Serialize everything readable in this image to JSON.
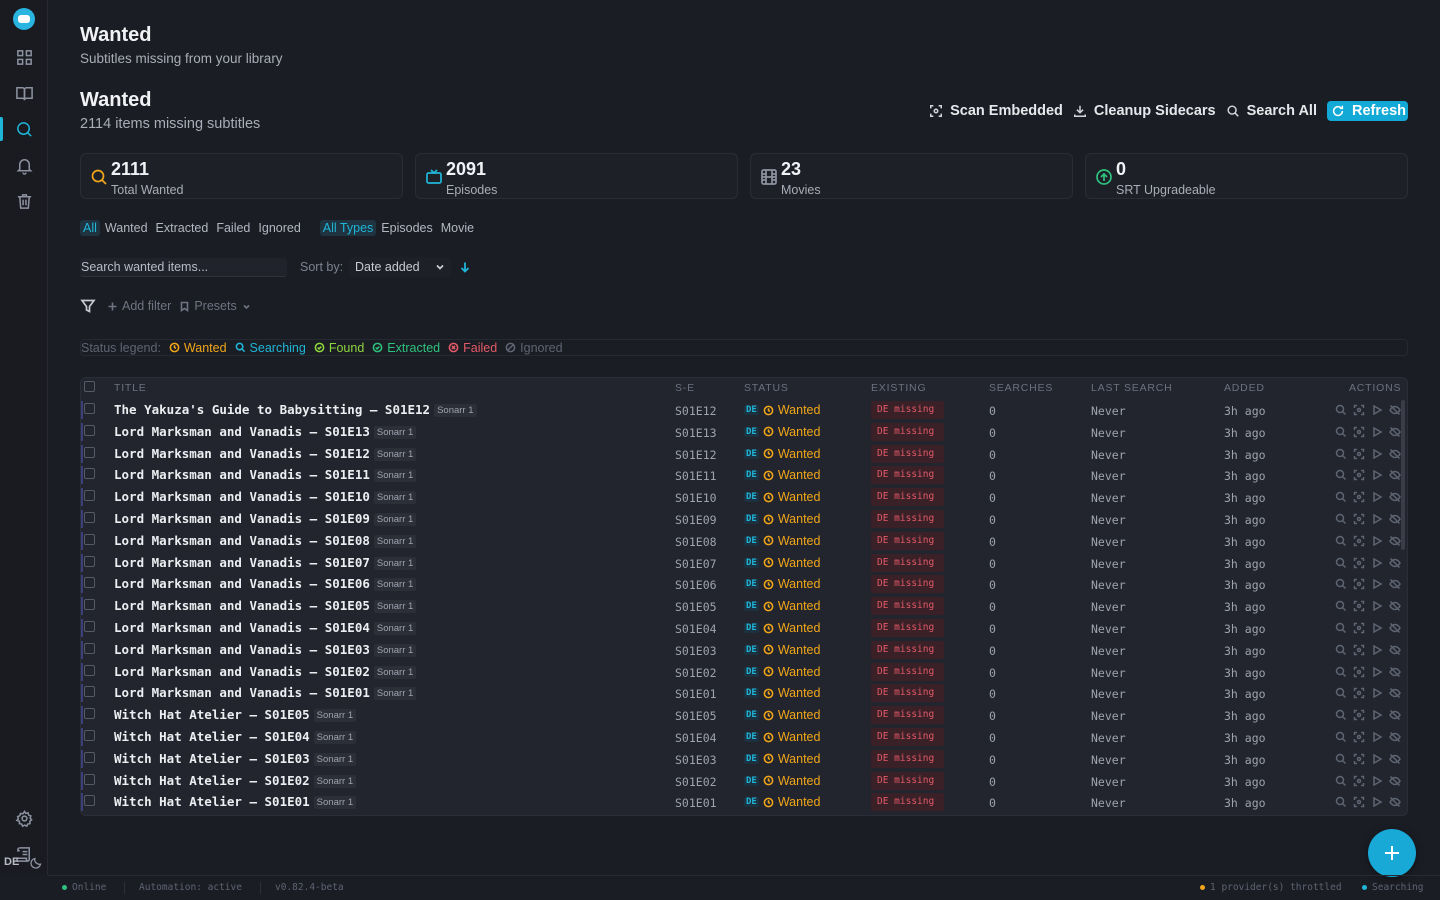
{
  "nav": {
    "items": [
      "dashboard-icon",
      "library-icon",
      "search-icon",
      "bell-icon",
      "trash-icon"
    ],
    "bottom": [
      "settings-icon",
      "log-icon"
    ],
    "language": "DE"
  },
  "page": {
    "title": "Wanted",
    "subtitle": "Subtitles missing from your library",
    "section_title": "Wanted",
    "section_subtitle": "2114 items missing subtitles"
  },
  "actions": {
    "scan": "Scan Embedded",
    "cleanup": "Cleanup Sidecars",
    "search_all": "Search All",
    "refresh": "Refresh"
  },
  "stats": [
    {
      "value": "2111",
      "label": "Total Wanted",
      "color": "#f1a61a"
    },
    {
      "value": "2091",
      "label": "Episodes",
      "color": "#1fb6d8"
    },
    {
      "value": "23",
      "label": "Movies",
      "color": "#8d92a0"
    },
    {
      "value": "0",
      "label": "SRT Upgradeable",
      "color": "#2ec27e"
    }
  ],
  "filters": {
    "status": [
      "All",
      "Wanted",
      "Extracted",
      "Failed",
      "Ignored"
    ],
    "types": [
      "All Types",
      "Episodes",
      "Movie"
    ]
  },
  "search": {
    "placeholder": "Search wanted items..."
  },
  "sort": {
    "label": "Sort by:",
    "value": "Date added"
  },
  "filterbar": {
    "add": "Add filter",
    "presets": "Presets"
  },
  "legend": {
    "label": "Status legend:",
    "items": [
      {
        "label": "Wanted",
        "color": "#f1a61a"
      },
      {
        "label": "Searching",
        "color": "#1fb6d8"
      },
      {
        "label": "Found",
        "color": "#8ed63e"
      },
      {
        "label": "Extracted",
        "color": "#2ec27e"
      },
      {
        "label": "Failed",
        "color": "#e35a68"
      },
      {
        "label": "Ignored",
        "color": "#5f6473"
      }
    ]
  },
  "table": {
    "headers": [
      "TITLE",
      "S-E",
      "STATUS",
      "EXISTING",
      "SEARCHES",
      "LAST SEARCH",
      "ADDED",
      "ACTIONS"
    ],
    "rows": [
      {
        "title": "The Yakuza's Guide to Babysitting – S01E12",
        "source": "Sonarr 1",
        "se": "S01E12",
        "lang": "DE",
        "status": "Wanted",
        "existing": "DE missing",
        "searches": "0",
        "last": "Never",
        "added": "3h ago"
      },
      {
        "title": "Lord Marksman and Vanadis – S01E13",
        "source": "Sonarr 1",
        "se": "S01E13",
        "lang": "DE",
        "status": "Wanted",
        "existing": "DE missing",
        "searches": "0",
        "last": "Never",
        "added": "3h ago"
      },
      {
        "title": "Lord Marksman and Vanadis – S01E12",
        "source": "Sonarr 1",
        "se": "S01E12",
        "lang": "DE",
        "status": "Wanted",
        "existing": "DE missing",
        "searches": "0",
        "last": "Never",
        "added": "3h ago"
      },
      {
        "title": "Lord Marksman and Vanadis – S01E11",
        "source": "Sonarr 1",
        "se": "S01E11",
        "lang": "DE",
        "status": "Wanted",
        "existing": "DE missing",
        "searches": "0",
        "last": "Never",
        "added": "3h ago"
      },
      {
        "title": "Lord Marksman and Vanadis – S01E10",
        "source": "Sonarr 1",
        "se": "S01E10",
        "lang": "DE",
        "status": "Wanted",
        "existing": "DE missing",
        "searches": "0",
        "last": "Never",
        "added": "3h ago"
      },
      {
        "title": "Lord Marksman and Vanadis – S01E09",
        "source": "Sonarr 1",
        "se": "S01E09",
        "lang": "DE",
        "status": "Wanted",
        "existing": "DE missing",
        "searches": "0",
        "last": "Never",
        "added": "3h ago"
      },
      {
        "title": "Lord Marksman and Vanadis – S01E08",
        "source": "Sonarr 1",
        "se": "S01E08",
        "lang": "DE",
        "status": "Wanted",
        "existing": "DE missing",
        "searches": "0",
        "last": "Never",
        "added": "3h ago"
      },
      {
        "title": "Lord Marksman and Vanadis – S01E07",
        "source": "Sonarr 1",
        "se": "S01E07",
        "lang": "DE",
        "status": "Wanted",
        "existing": "DE missing",
        "searches": "0",
        "last": "Never",
        "added": "3h ago"
      },
      {
        "title": "Lord Marksman and Vanadis – S01E06",
        "source": "Sonarr 1",
        "se": "S01E06",
        "lang": "DE",
        "status": "Wanted",
        "existing": "DE missing",
        "searches": "0",
        "last": "Never",
        "added": "3h ago"
      },
      {
        "title": "Lord Marksman and Vanadis – S01E05",
        "source": "Sonarr 1",
        "se": "S01E05",
        "lang": "DE",
        "status": "Wanted",
        "existing": "DE missing",
        "searches": "0",
        "last": "Never",
        "added": "3h ago"
      },
      {
        "title": "Lord Marksman and Vanadis – S01E04",
        "source": "Sonarr 1",
        "se": "S01E04",
        "lang": "DE",
        "status": "Wanted",
        "existing": "DE missing",
        "searches": "0",
        "last": "Never",
        "added": "3h ago"
      },
      {
        "title": "Lord Marksman and Vanadis – S01E03",
        "source": "Sonarr 1",
        "se": "S01E03",
        "lang": "DE",
        "status": "Wanted",
        "existing": "DE missing",
        "searches": "0",
        "last": "Never",
        "added": "3h ago"
      },
      {
        "title": "Lord Marksman and Vanadis – S01E02",
        "source": "Sonarr 1",
        "se": "S01E02",
        "lang": "DE",
        "status": "Wanted",
        "existing": "DE missing",
        "searches": "0",
        "last": "Never",
        "added": "3h ago"
      },
      {
        "title": "Lord Marksman and Vanadis – S01E01",
        "source": "Sonarr 1",
        "se": "S01E01",
        "lang": "DE",
        "status": "Wanted",
        "existing": "DE missing",
        "searches": "0",
        "last": "Never",
        "added": "3h ago"
      },
      {
        "title": "Witch Hat Atelier – S01E05",
        "source": "Sonarr 1",
        "se": "S01E05",
        "lang": "DE",
        "status": "Wanted",
        "existing": "DE missing",
        "searches": "0",
        "last": "Never",
        "added": "3h ago"
      },
      {
        "title": "Witch Hat Atelier – S01E04",
        "source": "Sonarr 1",
        "se": "S01E04",
        "lang": "DE",
        "status": "Wanted",
        "existing": "DE missing",
        "searches": "0",
        "last": "Never",
        "added": "3h ago"
      },
      {
        "title": "Witch Hat Atelier – S01E03",
        "source": "Sonarr 1",
        "se": "S01E03",
        "lang": "DE",
        "status": "Wanted",
        "existing": "DE missing",
        "searches": "0",
        "last": "Never",
        "added": "3h ago"
      },
      {
        "title": "Witch Hat Atelier – S01E02",
        "source": "Sonarr 1",
        "se": "S01E02",
        "lang": "DE",
        "status": "Wanted",
        "existing": "DE missing",
        "searches": "0",
        "last": "Never",
        "added": "3h ago"
      },
      {
        "title": "Witch Hat Atelier – S01E01",
        "source": "Sonarr 1",
        "se": "S01E01",
        "lang": "DE",
        "status": "Wanted",
        "existing": "DE missing",
        "searches": "0",
        "last": "Never",
        "added": "3h ago"
      }
    ]
  },
  "footer": {
    "online": "Online",
    "automation": "Automation: active",
    "version": "v0.82.4-beta",
    "throttled": "1 provider(s) throttled",
    "searching": "Searching"
  }
}
